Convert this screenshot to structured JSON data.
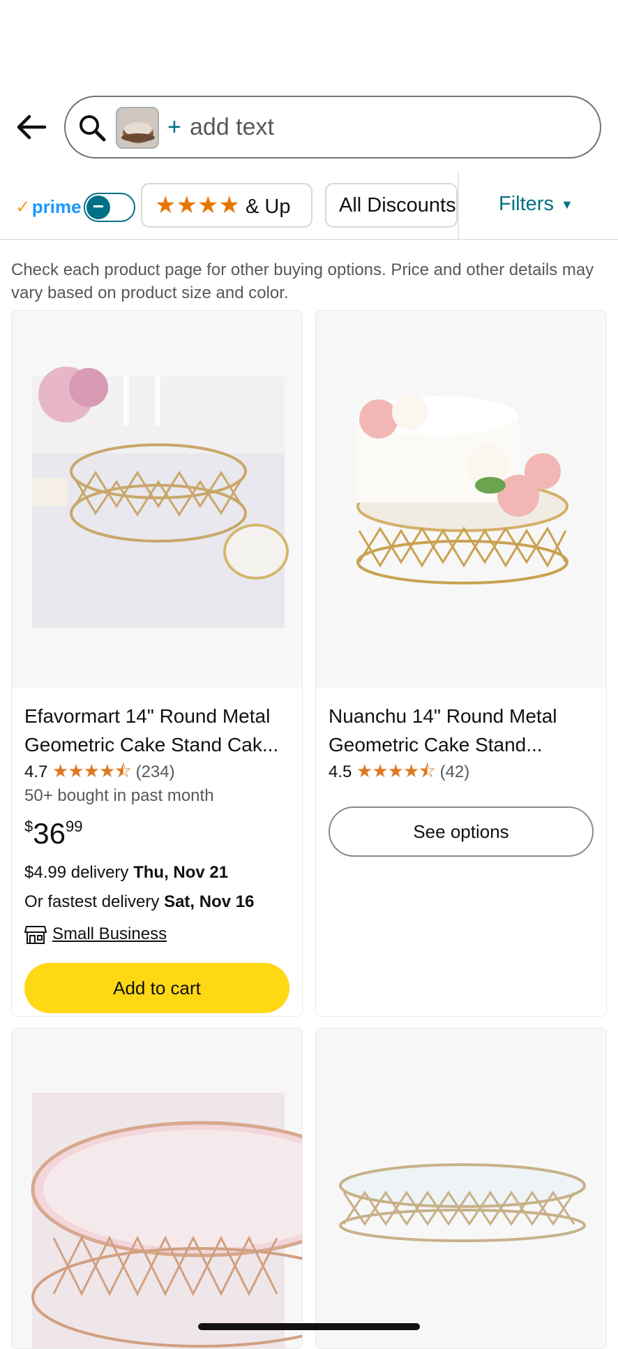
{
  "search": {
    "placeholder": "add text",
    "plus": "+"
  },
  "filters": {
    "prime_label": "prime",
    "stars_chip": "& Up",
    "discounts_chip": "All Discounts",
    "filters_label": "Filters"
  },
  "note": "Check each product page for other buying options. Price and other details may vary based on product size and color.",
  "products": [
    {
      "title": "Efavormart 14\" Round Metal Geometric Cake Stand Cak...",
      "rating": "4.7",
      "rating_value": 4.7,
      "reviews": "(234)",
      "bought": "50+ bought in past month",
      "price_symbol": "$",
      "price_whole": "36",
      "price_fraction": "99",
      "delivery_prefix": "$4.99 delivery ",
      "delivery_date": "Thu, Nov 21",
      "fastest_prefix": "Or fastest delivery ",
      "fastest_date": "Sat, Nov 16",
      "badge": "Small Business",
      "button": "Add to cart"
    },
    {
      "title": "Nuanchu 14\" Round Metal Geometric Cake Stand...",
      "rating": "4.5",
      "rating_value": 4.5,
      "reviews": "(42)",
      "button": "See options"
    }
  ],
  "colors": {
    "accent": "#007185",
    "cart_button": "#ffd814",
    "star": "#de7921",
    "prime": "#1a98ff"
  }
}
